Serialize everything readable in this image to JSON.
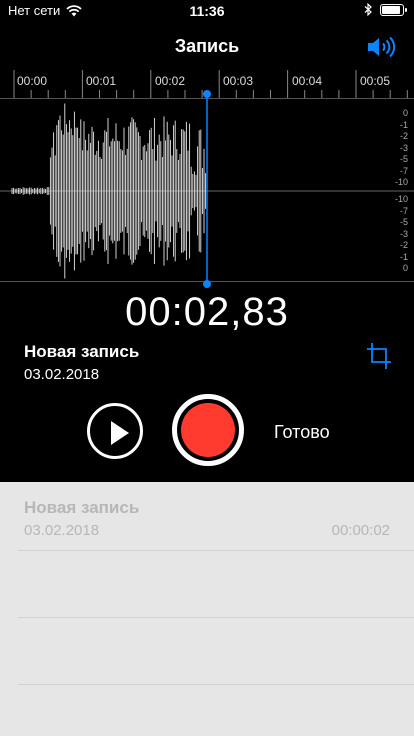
{
  "status_bar": {
    "carrier": "Нет сети",
    "time": "11:36",
    "battery_level": 0.9
  },
  "header": {
    "title": "Запись"
  },
  "timeline": {
    "ticks": [
      "00:00",
      "00:01",
      "00:02",
      "00:03",
      "00:04",
      "00:05"
    ]
  },
  "level_scale": {
    "upper": [
      "0",
      "-1",
      "-2",
      "-3",
      "-5",
      "-7",
      "-10"
    ],
    "lower": [
      "-10",
      "-7",
      "-5",
      "-3",
      "-2",
      "-1",
      "0"
    ]
  },
  "recording": {
    "timer": "00:02,83",
    "name": "Новая запись",
    "date": "03.02.2018"
  },
  "controls": {
    "done_label": "Готово"
  },
  "list": {
    "items": [
      {
        "title": "Новая запись",
        "date": "03.02.2018",
        "duration": "00:00:02"
      }
    ]
  },
  "colors": {
    "accent": "#0a84ff",
    "record": "#ff3b30",
    "list_bg": "#e6e6e6",
    "list_text": "#b7b7b7"
  }
}
